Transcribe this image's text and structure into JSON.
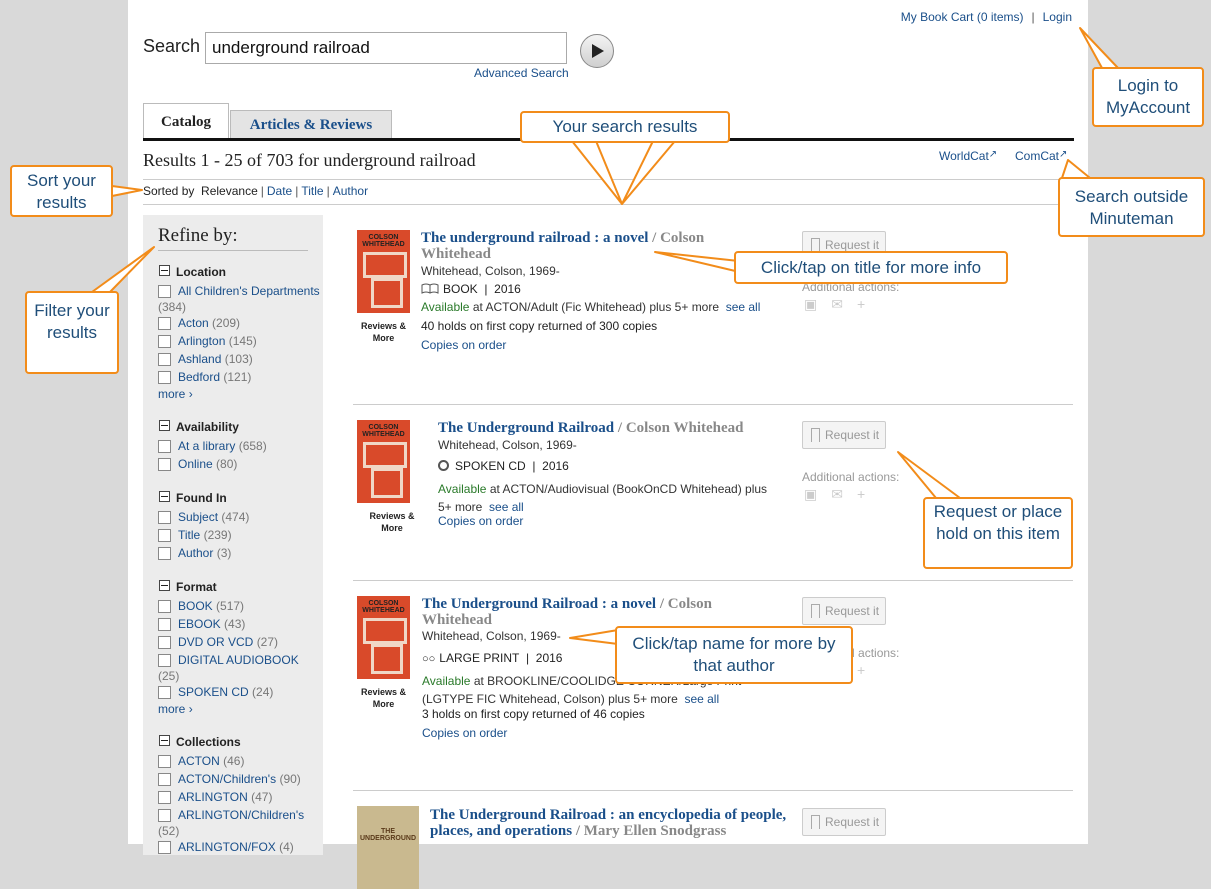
{
  "topnav": {
    "cart": "My Book Cart (0 items)",
    "sep": "|",
    "login": "Login"
  },
  "search": {
    "label": "Search",
    "value": "underground railroad",
    "advanced": "Advanced Search"
  },
  "tabs": [
    {
      "label": "Catalog"
    },
    {
      "label": "Articles & Reviews"
    }
  ],
  "results_summary": "Results 1 - 25 of 703 for underground railroad",
  "external": {
    "worldcat": "WorldCat",
    "comcat": "ComCat"
  },
  "sort": {
    "prefix": "Sorted by",
    "current": "Relevance",
    "date": "Date",
    "title": "Title",
    "author": "Author",
    "sep": "|"
  },
  "sidebar": {
    "heading": "Refine by:",
    "more": "more",
    "facets": [
      {
        "name": "Location",
        "items": [
          {
            "label": "All Children's Departments",
            "count": "(384)"
          },
          {
            "label": "Acton",
            "count": "(209)"
          },
          {
            "label": "Arlington",
            "count": "(145)"
          },
          {
            "label": "Ashland",
            "count": "(103)"
          },
          {
            "label": "Bedford",
            "count": "(121)"
          }
        ]
      },
      {
        "name": "Availability",
        "items": [
          {
            "label": "At a library",
            "count": "(658)"
          },
          {
            "label": "Online",
            "count": "(80)"
          }
        ]
      },
      {
        "name": "Found In",
        "items": [
          {
            "label": "Subject",
            "count": "(474)"
          },
          {
            "label": "Title",
            "count": "(239)"
          },
          {
            "label": "Author",
            "count": "(3)"
          }
        ]
      },
      {
        "name": "Format",
        "items": [
          {
            "label": "BOOK",
            "count": "(517)"
          },
          {
            "label": "EBOOK",
            "count": "(43)"
          },
          {
            "label": "DVD OR VCD",
            "count": "(27)"
          },
          {
            "label": "DIGITAL AUDIOBOOK",
            "count": "(25)"
          },
          {
            "label": "SPOKEN CD",
            "count": "(24)"
          }
        ]
      },
      {
        "name": "Collections",
        "items": [
          {
            "label": "ACTON",
            "count": "(46)"
          },
          {
            "label": "ACTON/Children's",
            "count": "(90)"
          },
          {
            "label": "ARLINGTON",
            "count": "(47)"
          },
          {
            "label": "ARLINGTON/Children's",
            "count": "(52)"
          },
          {
            "label": "ARLINGTON/FOX",
            "count": "(4)"
          }
        ]
      }
    ]
  },
  "results": [
    {
      "title": "The underground railroad : a novel",
      "author_sep": " / Colson Whitehead",
      "author_link": "Whitehead, Colson, 1969-",
      "format": "BOOK",
      "year": "2016",
      "sep": "|",
      "available": "Available",
      "avail_rest": " at ACTON/Adult (Fic Whitehead) plus 5+ more",
      "see_all": "see all",
      "holds": "40 holds on first copy returned of 300 copies",
      "order": "Copies on order",
      "cover_label": "Reviews & More",
      "cover_text": "COLSON WHITEHEAD"
    },
    {
      "title": "The Underground Railroad",
      "author_sep": " / Colson Whitehead",
      "author_link": "Whitehead, Colson, 1969-",
      "format": "SPOKEN CD",
      "year": "2016",
      "sep": "|",
      "available": "Available",
      "avail_rest": " at ACTON/Audiovisual (BookOnCD Whitehead) plus 5+ more",
      "see_all": "see all",
      "order": "Copies on order",
      "cover_label": "Reviews & More",
      "cover_text": "COLSON WHITEHEAD"
    },
    {
      "title": "The Underground Railroad : a novel",
      "author_sep": " / Colson Whitehead",
      "author_link": "Whitehead, Colson, 1969-",
      "format": "LARGE PRINT",
      "year": "2016",
      "sep": "|",
      "available": "Available",
      "avail_rest": " at BROOKLINE/COOLIDGE CORNER/Large Print (LGTYPE FIC Whitehead, Colson) plus 5+ more",
      "see_all": "see all",
      "holds": "3 holds on first copy returned of 46 copies",
      "order": "Copies on order",
      "cover_label": "Reviews & More",
      "cover_text": "COLSON WHITEHEAD"
    },
    {
      "title": "The Underground Railroad : an encyclopedia of people, places, and operations",
      "author_sep": " / Mary Ellen Snodgrass",
      "cover_text": "THE UNDERGROUND"
    }
  ],
  "actions": {
    "request": "Request it",
    "additional": "Additional actions:"
  },
  "callouts": {
    "login": "Login to MyAccount",
    "results": "Your search results",
    "sort": "Sort your results",
    "outside": "Search outside Minuteman",
    "title": "Click/tap on title for more info",
    "filter": "Filter your results",
    "request": "Request or place hold on this item",
    "author": "Click/tap name for more by that author"
  },
  "colors": {
    "callout_border": "#f28c1a",
    "callout_text": "#1f4e79",
    "link": "#1a4f8a",
    "available": "#2a7a2a"
  }
}
